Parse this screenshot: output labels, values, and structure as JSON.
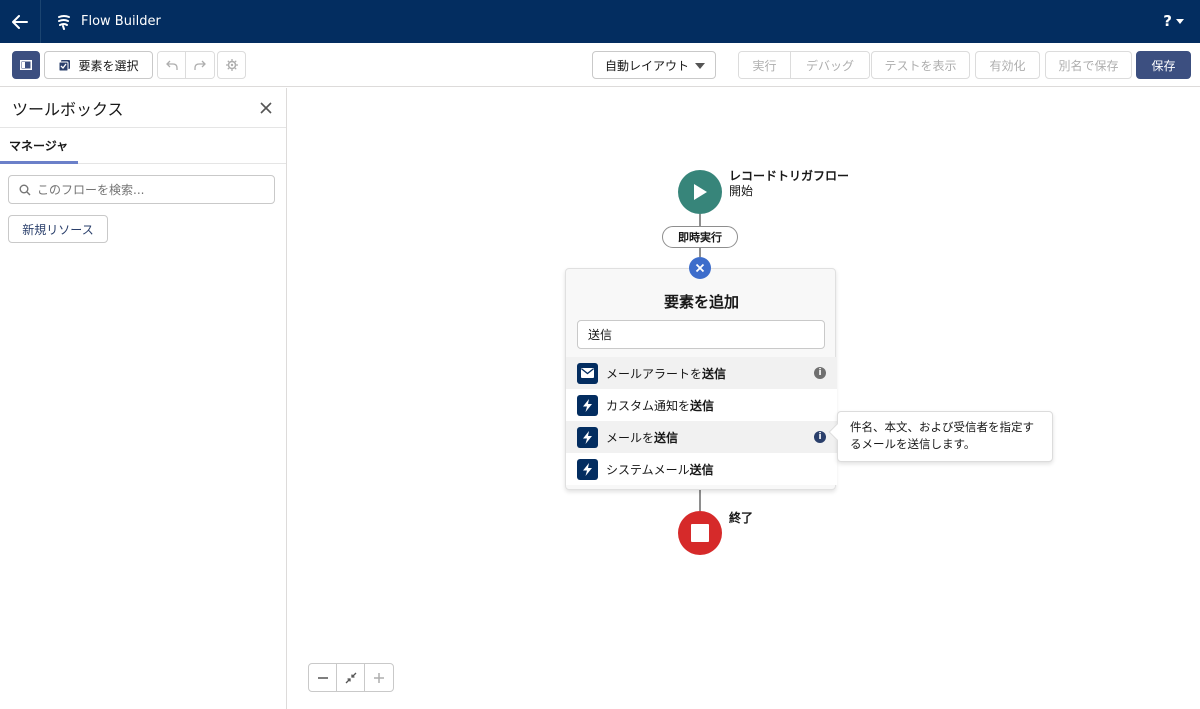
{
  "header": {
    "app_title": "Flow Builder",
    "help_label": "?"
  },
  "toolbar": {
    "select_elements_label": "要素を選択",
    "layout_select_value": "自動レイアウト",
    "run_label": "実行",
    "debug_label": "デバッグ",
    "view_tests_label": "テストを表示",
    "activate_label": "有効化",
    "save_as_label": "別名で保存",
    "save_label": "保存"
  },
  "toolbox": {
    "title": "ツールボックス",
    "tab_label": "マネージャ",
    "search_placeholder": "このフローを検索...",
    "new_resource_label": "新規リソース"
  },
  "canvas": {
    "start_title": "レコードトリガフロー",
    "start_subtitle": "開始",
    "path_label": "即時実行",
    "end_label": "終了"
  },
  "add_element": {
    "title": "要素を追加",
    "search_value": "送信",
    "items": [
      {
        "prefix": "メールアラートを",
        "match": "送信",
        "icon": "envelope-icon",
        "has_info": true
      },
      {
        "prefix": "カスタム通知を",
        "match": "送信",
        "icon": "lightning-icon",
        "has_info": false
      },
      {
        "prefix": "メールを",
        "match": "送信",
        "icon": "lightning-icon",
        "has_info": true
      },
      {
        "prefix": "システムメール",
        "match": "送信",
        "icon": "lightning-icon",
        "has_info": false
      }
    ],
    "tooltip_line1": "件名、本文、および受信者を指定す",
    "tooltip_line2": "るメールを送信します。"
  },
  "colors": {
    "header_bg": "#032d60",
    "start_node": "#37857a",
    "end_node": "#d62a2a",
    "close_circle": "#3d6dcb",
    "save_button": "#3c4f80"
  }
}
